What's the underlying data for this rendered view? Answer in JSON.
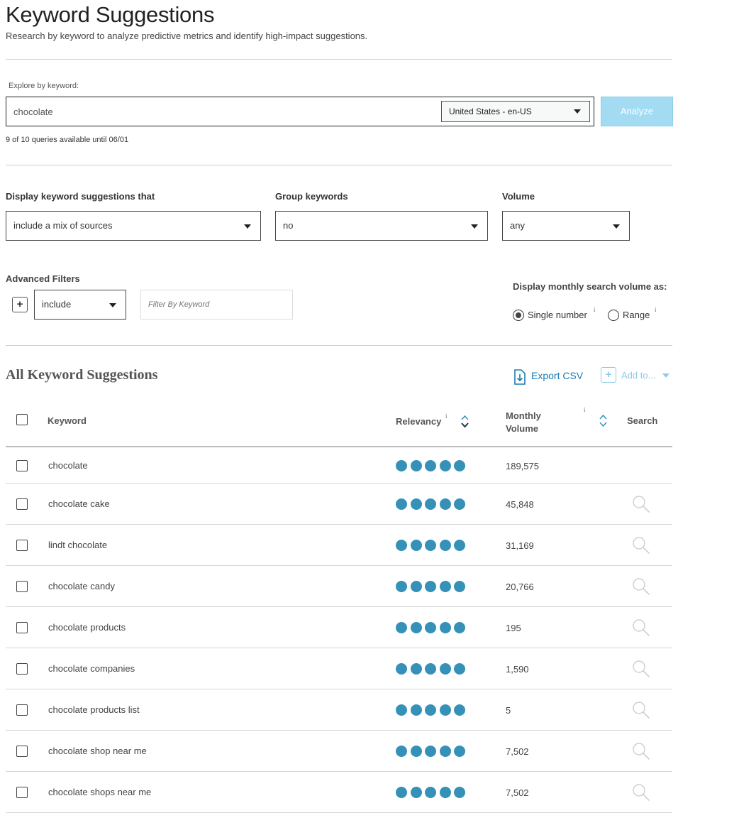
{
  "header": {
    "title": "Keyword Suggestions",
    "subtitle": "Research by keyword to analyze predictive metrics and identify high-impact suggestions."
  },
  "explore": {
    "label": "Explore by keyword:",
    "keyword": "chocolate",
    "locale": "United States - en-US",
    "analyze_label": "Analyze",
    "queries_note": "9 of 10 queries available until 06/01"
  },
  "filters": {
    "display_label": "Display keyword suggestions that",
    "display_value": "include a mix of sources",
    "group_label": "Group keywords",
    "group_value": "no",
    "volume_label": "Volume",
    "volume_value": "any"
  },
  "advanced": {
    "label": "Advanced Filters",
    "mode_value": "include",
    "filter_placeholder": "Filter By Keyword",
    "display_as_label": "Display monthly search volume as:",
    "single_label": "Single number",
    "range_label": "Range",
    "info_glyph": "i"
  },
  "results": {
    "title": "All Keyword Suggestions",
    "export_label": "Export CSV",
    "addto_label": "Add to...",
    "columns": {
      "keyword": "Keyword",
      "relevancy": "Relevancy",
      "volume_line1": "Monthly",
      "volume_line2": "Volume",
      "search": "Search"
    },
    "rows": [
      {
        "keyword": "chocolate",
        "relevancy": 5,
        "volume": "189,575",
        "search_icon": false
      },
      {
        "keyword": "chocolate cake",
        "relevancy": 5,
        "volume": "45,848",
        "search_icon": true
      },
      {
        "keyword": "lindt chocolate",
        "relevancy": 5,
        "volume": "31,169",
        "search_icon": true
      },
      {
        "keyword": "chocolate candy",
        "relevancy": 5,
        "volume": "20,766",
        "search_icon": true
      },
      {
        "keyword": "chocolate products",
        "relevancy": 5,
        "volume": "195",
        "search_icon": true
      },
      {
        "keyword": "chocolate companies",
        "relevancy": 5,
        "volume": "1,590",
        "search_icon": true
      },
      {
        "keyword": "chocolate products list",
        "relevancy": 5,
        "volume": "5",
        "search_icon": true
      },
      {
        "keyword": "chocolate shop near me",
        "relevancy": 5,
        "volume": "7,502",
        "search_icon": true
      },
      {
        "keyword": "chocolate shops near me",
        "relevancy": 5,
        "volume": "7,502",
        "search_icon": true
      }
    ]
  },
  "colors": {
    "accent": "#1a7db3",
    "relevancy_dot": "#3591b8",
    "analyze_bg": "#a3dcf2"
  }
}
